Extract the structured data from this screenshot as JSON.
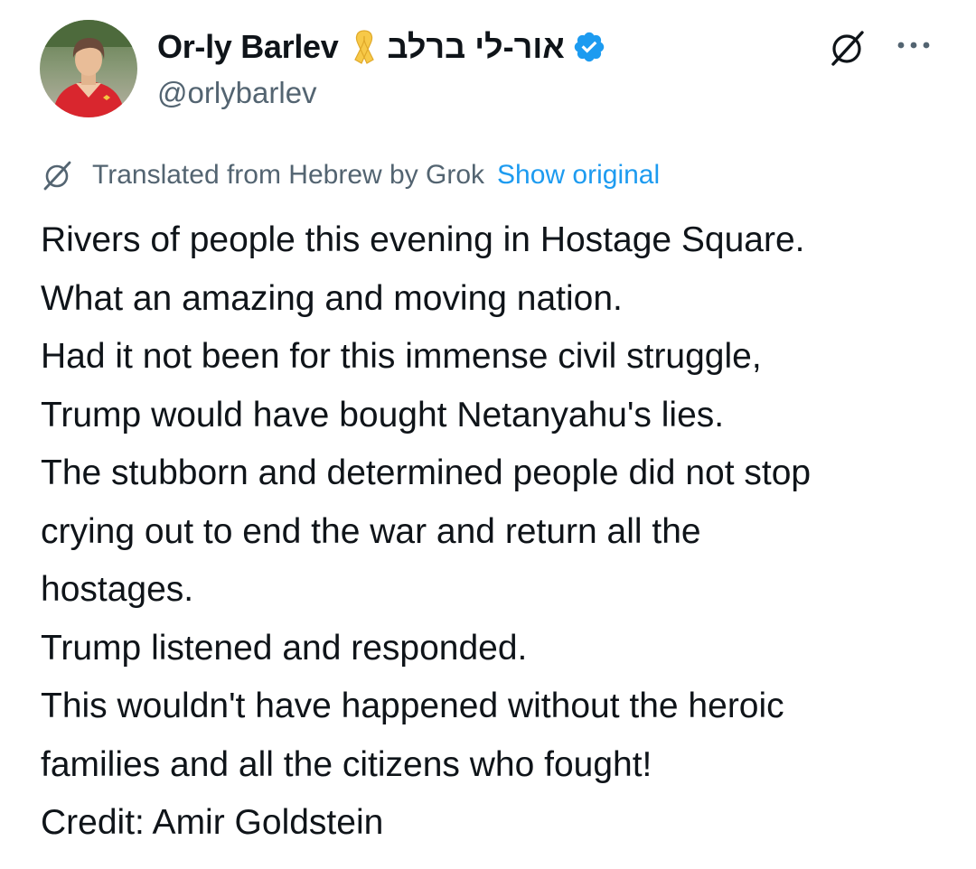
{
  "post": {
    "author": {
      "display_name": "Or-ly Barlev",
      "hebrew_name": "אור-לי ברלב",
      "handle": "@orlybarlev",
      "ribbon_icon": "yellow-ribbon-icon",
      "verified_icon": "verified-badge-icon"
    },
    "actions": {
      "grok_icon": "grok-icon",
      "more_icon": "more-options-icon"
    },
    "translation": {
      "label": "Translated from Hebrew by Grok",
      "show_original": "Show original"
    },
    "text_lines": [
      "Rivers of people this evening in Hostage Square.",
      "What an amazing and moving nation.",
      "Had it not been for this immense civil struggle,",
      "Trump would have bought Netanyahu's lies.",
      "The stubborn and determined people did not stop",
      "crying out to end the war and return all the",
      "hostages.",
      "Trump listened and responded.",
      "This wouldn't have happened without the heroic",
      "families and all the citizens who fought!",
      "Credit: Amir Goldstein"
    ],
    "colors": {
      "text": "#0f1419",
      "secondary": "#536471",
      "link": "#1d9bf0",
      "verified": "#1d9bf0",
      "ribbon": "#f7c948"
    }
  }
}
